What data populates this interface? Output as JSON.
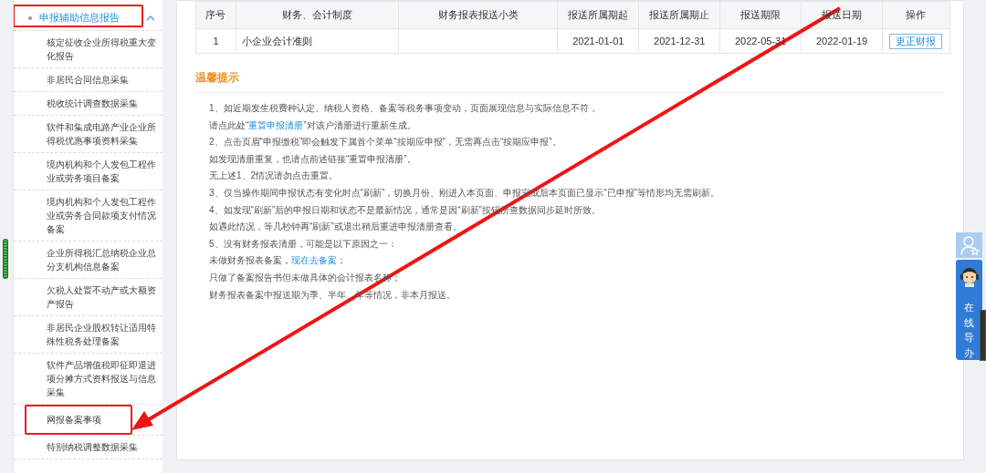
{
  "sidebar": {
    "group": {
      "label": "申报辅助信息报告",
      "expanded": true,
      "highlighted": true
    },
    "items": [
      {
        "label": "核定征收企业所得税重大变化报告",
        "highlighted": false
      },
      {
        "label": "非居民合同信息采集",
        "highlighted": false
      },
      {
        "label": "税收统计调查数据采集",
        "highlighted": false
      },
      {
        "label": "软件和集成电路产业企业所得税优惠事项资料采集",
        "highlighted": false
      },
      {
        "label": "境内机构和个人发包工程作业或劳务项目备案",
        "highlighted": false
      },
      {
        "label": "境内机构和个人发包工程作业或劳务合同款项支付情况备案",
        "highlighted": false
      },
      {
        "label": "企业所得税汇总纳税企业总分支机构信息备案",
        "highlighted": false
      },
      {
        "label": "欠税人处置不动产或大额资产报告",
        "highlighted": false
      },
      {
        "label": "非居民企业股权转让适用特殊性税务处理备案",
        "highlighted": false
      },
      {
        "label": "软件产品增值税即征即退进项分摊方式资料报送与信息采集",
        "highlighted": false
      },
      {
        "label": "网报备案事项",
        "highlighted": true
      },
      {
        "label": "特别纳税调整数据采集",
        "highlighted": false
      }
    ]
  },
  "table": {
    "columns": [
      "序号",
      "财务、会计制度",
      "财务报表报送小类",
      "报送所属期起",
      "报送所属期止",
      "报送期限",
      "报送日期",
      "操作"
    ],
    "rows": [
      {
        "cells": [
          "1",
          "小企业会计准则",
          "",
          "2021-01-01",
          "2021-12-31",
          "2022-05-31",
          "2022-01-19"
        ],
        "action": "更正财报"
      }
    ]
  },
  "tips": {
    "title": "温馨提示",
    "lines": [
      [
        {
          "text": "1、如近期发生税费种认定、纳税人资格、备案等税务事项变动，页面展现信息与实际信息不符，",
          "link": false
        }
      ],
      [
        {
          "text": "请点此处“",
          "link": false
        },
        {
          "text": "重置申报清册",
          "link": true
        },
        {
          "text": "”对该户清册进行重新生成。",
          "link": false
        }
      ],
      [
        {
          "text": "2、点击页眉“申报缴税”即会触发下属首个菜单“按期应申报”，无需再点击“按期应申报”。",
          "link": false
        }
      ],
      [
        {
          "text": "如发现清册重复，也请点前述链接“重置申报清册”。",
          "link": false
        }
      ],
      [
        {
          "text": "无上述1、2情况请勿点击重置。",
          "link": false
        }
      ],
      [
        {
          "text": "3、仅当操作期间申报状态有变化时点“刷新”，切换月份、刚进入本页面、申报完成后本页面已显示“已申报”等情形均无需刷新。",
          "link": false
        }
      ],
      [
        {
          "text": "4、如发现“刷新”后的申报日期和状态不是最新情况，通常是因“刷新”按钮所查数据同步延时所致。",
          "link": false
        }
      ],
      [
        {
          "text": "如遇此情况，等几秒钟再“刷新”或退出稍后重进申报清册查看。",
          "link": false
        }
      ],
      [
        {
          "text": "5、没有财务报表清册，可能是以下原因之一：",
          "link": false
        }
      ],
      [
        {
          "text": "未做财务报表备案，",
          "link": false
        },
        {
          "text": "现在去备案",
          "link": true
        },
        {
          "text": "；",
          "link": false
        }
      ],
      [
        {
          "text": "只做了备案报告书但未做具体的会计报表名称；",
          "link": false
        }
      ],
      [
        {
          "text": "财务报表备案中报送期为季、半年、年等情况，非本月报送。",
          "link": false
        }
      ]
    ]
  },
  "helper": {
    "label": "在线导办"
  }
}
